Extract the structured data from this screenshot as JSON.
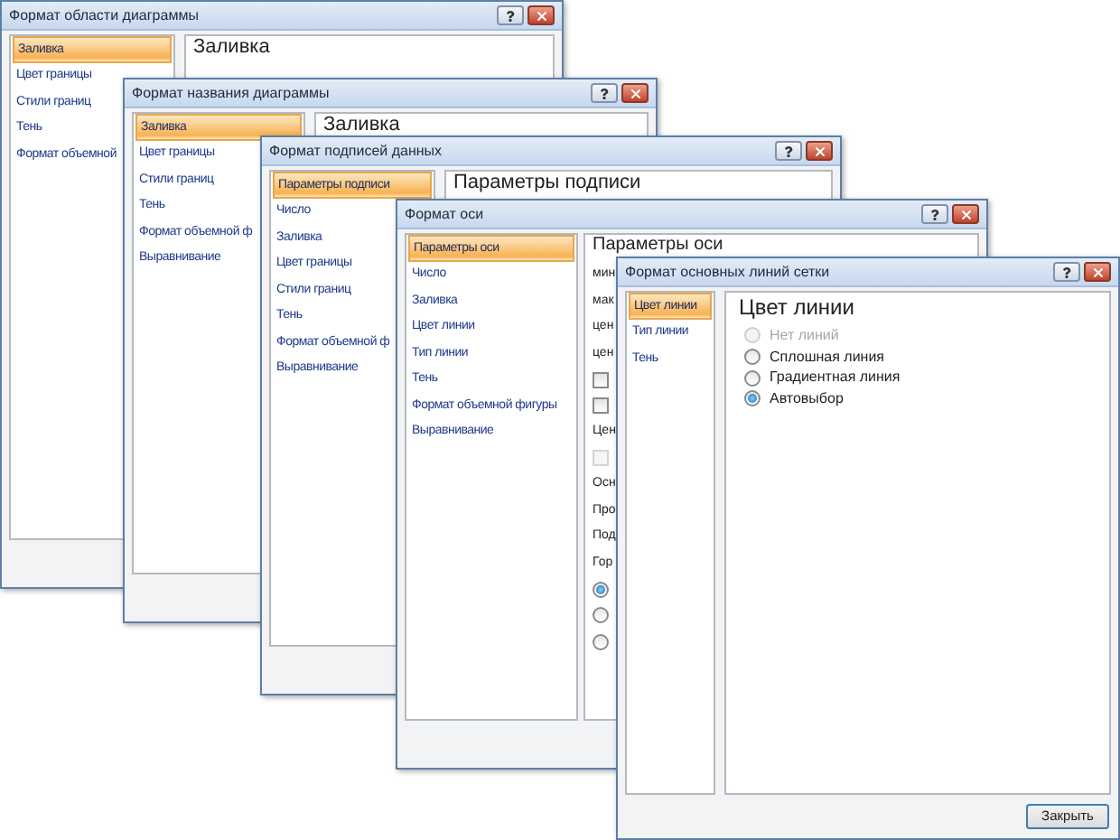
{
  "windows": [
    {
      "title": "Формат области диаграммы",
      "nav": [
        {
          "label": "Заливка",
          "selected": true
        },
        {
          "label": "Цвет границы",
          "selected": false
        },
        {
          "label": "Стили границ",
          "selected": false
        },
        {
          "label": "Тень",
          "selected": false
        },
        {
          "label": "Формат объемной",
          "selected": false
        }
      ],
      "heading": "Заливка"
    },
    {
      "title": "Формат названия диаграммы",
      "nav": [
        {
          "label": "Заливка",
          "selected": true
        },
        {
          "label": "Цвет границы",
          "selected": false
        },
        {
          "label": "Стили границ",
          "selected": false
        },
        {
          "label": "Тень",
          "selected": false
        },
        {
          "label": "Формат объемной ф",
          "selected": false
        },
        {
          "label": "Выравнивание",
          "selected": false
        }
      ],
      "heading": "Заливка"
    },
    {
      "title": "Формат подписей данных",
      "nav": [
        {
          "label": "Параметры подписи",
          "selected": true
        },
        {
          "label": "Число",
          "selected": false
        },
        {
          "label": "Заливка",
          "selected": false
        },
        {
          "label": "Цвет границы",
          "selected": false
        },
        {
          "label": "Стили границ",
          "selected": false
        },
        {
          "label": "Тень",
          "selected": false
        },
        {
          "label": "Формат объемной ф",
          "selected": false
        },
        {
          "label": "Выравнивание",
          "selected": false
        }
      ],
      "heading": "Параметры подписи"
    },
    {
      "title": "Формат оси",
      "nav": [
        {
          "label": "Параметры оси",
          "selected": true
        },
        {
          "label": "Число",
          "selected": false
        },
        {
          "label": "Заливка",
          "selected": false
        },
        {
          "label": "Цвет линии",
          "selected": false
        },
        {
          "label": "Тип линии",
          "selected": false
        },
        {
          "label": "Тень",
          "selected": false
        },
        {
          "label": "Формат объемной фигуры",
          "selected": false
        },
        {
          "label": "Выравнивание",
          "selected": false
        }
      ],
      "heading": "Параметры оси",
      "controls": [
        {
          "kind": "text",
          "label": "мин"
        },
        {
          "kind": "text",
          "label": "мак"
        },
        {
          "kind": "text",
          "label": "цен"
        },
        {
          "kind": "text",
          "label": "цен"
        },
        {
          "kind": "checkbox",
          "checked": false,
          "disabled": false
        },
        {
          "kind": "checkbox",
          "checked": false,
          "disabled": false
        },
        {
          "kind": "text",
          "label": "Цен"
        },
        {
          "kind": "checkbox",
          "checked": false,
          "disabled": true
        },
        {
          "kind": "text",
          "label": "Осн"
        },
        {
          "kind": "text",
          "label": "Про"
        },
        {
          "kind": "text",
          "label": "Под"
        },
        {
          "kind": "text",
          "label": "Гор"
        },
        {
          "kind": "radio",
          "selected": true
        },
        {
          "kind": "radio",
          "selected": false
        },
        {
          "kind": "radio",
          "selected": false
        }
      ]
    },
    {
      "title": "Формат основных линий сетки",
      "nav": [
        {
          "label": "Цвет линии",
          "selected": true
        },
        {
          "label": "Тип линии",
          "selected": false
        },
        {
          "label": "Тень",
          "selected": false
        }
      ],
      "heading": "Цвет линии",
      "controls": [
        {
          "kind": "radio",
          "label": "Нет линий",
          "selected": false,
          "disabled": true
        },
        {
          "kind": "radio",
          "label": "Сплошная линия",
          "selected": false,
          "disabled": false
        },
        {
          "kind": "radio",
          "label": "Градиентная линия",
          "selected": false,
          "disabled": false
        },
        {
          "kind": "radio",
          "label": "Автовыбор",
          "selected": true,
          "disabled": false
        }
      ],
      "buttons": [
        "Закрыть"
      ]
    }
  ]
}
